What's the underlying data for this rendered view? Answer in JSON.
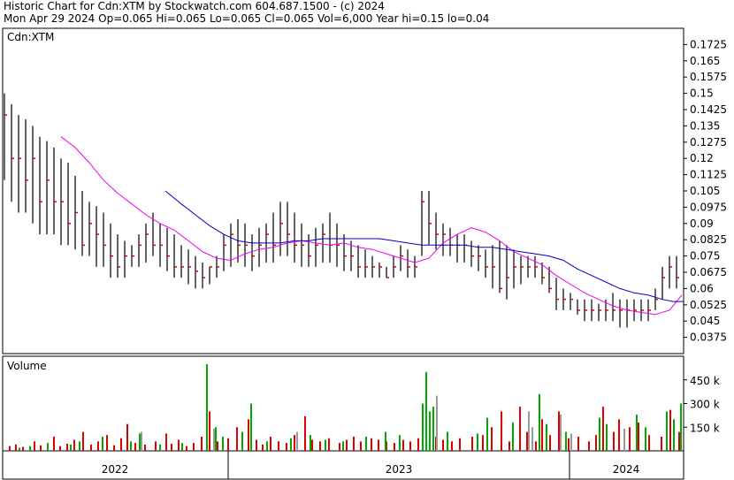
{
  "header": {
    "line1": "Historic Chart for Cdn:XTM by Stockwatch.com 604.687.1500 - (c) 2024",
    "line2": "Mon Apr 29 2024  Op=0.065  Hi=0.065  Lo=0.065  Cl=0.065  Vol=6,000  Year hi=0.15  lo=0.04"
  },
  "chart_data": [
    {
      "type": "line",
      "title": "Cdn:XTM",
      "ylim": [
        0.03,
        0.18
      ],
      "y_ticks": [
        "0.1725",
        "0.165",
        "0.1575",
        "0.15",
        "0.1425",
        "0.135",
        "0.1275",
        "0.12",
        "0.1125",
        "0.105",
        "0.0975",
        "0.09",
        "0.0825",
        "0.075",
        "0.0675",
        "0.06",
        "0.0525",
        "0.045",
        "0.0375"
      ],
      "x_ticks": [
        "2022",
        "2023",
        "2024"
      ],
      "series": [
        {
          "style": "hlc-bars",
          "color": "#000000",
          "tick_color": "#dd0000",
          "x": [
            0,
            8,
            16,
            24,
            32,
            40,
            48,
            56,
            64,
            72,
            80,
            88,
            96,
            104,
            112,
            120,
            128,
            136,
            144,
            152,
            160,
            168,
            176,
            184,
            192,
            200,
            208,
            216,
            224,
            232,
            240,
            248,
            256,
            264,
            272,
            280,
            288,
            296,
            304,
            312,
            320,
            328,
            336,
            344,
            352,
            360,
            368,
            376,
            384,
            392,
            400,
            408,
            416,
            424,
            432,
            440,
            448,
            456,
            464,
            472,
            480,
            488,
            496,
            504,
            512,
            520,
            528,
            536,
            544,
            552,
            560,
            568,
            576,
            584,
            592,
            600,
            608,
            616,
            624,
            632,
            640,
            648,
            656,
            664,
            672,
            680,
            688,
            696,
            704,
            712,
            720,
            728,
            736,
            744,
            752,
            760
          ],
          "hi": [
            0.15,
            0.145,
            0.14,
            0.138,
            0.135,
            0.13,
            0.128,
            0.125,
            0.12,
            0.118,
            0.112,
            0.105,
            0.1,
            0.098,
            0.095,
            0.09,
            0.085,
            0.082,
            0.08,
            0.085,
            0.09,
            0.095,
            0.09,
            0.088,
            0.085,
            0.08,
            0.078,
            0.075,
            0.072,
            0.07,
            0.075,
            0.085,
            0.09,
            0.092,
            0.09,
            0.085,
            0.088,
            0.09,
            0.095,
            0.1,
            0.1,
            0.095,
            0.09,
            0.085,
            0.088,
            0.09,
            0.095,
            0.09,
            0.085,
            0.082,
            0.08,
            0.078,
            0.075,
            0.072,
            0.07,
            0.075,
            0.08,
            0.078,
            0.075,
            0.105,
            0.105,
            0.095,
            0.09,
            0.088,
            0.085,
            0.085,
            0.082,
            0.08,
            0.078,
            0.08,
            0.082,
            0.08,
            0.078,
            0.075,
            0.075,
            0.075,
            0.072,
            0.07,
            0.065,
            0.06,
            0.058,
            0.055,
            0.055,
            0.055,
            0.053,
            0.055,
            0.058,
            0.055,
            0.055,
            0.055,
            0.055,
            0.055,
            0.06,
            0.07,
            0.075,
            0.075
          ],
          "lo": [
            0.11,
            0.1,
            0.095,
            0.095,
            0.09,
            0.085,
            0.085,
            0.085,
            0.08,
            0.08,
            0.078,
            0.075,
            0.075,
            0.07,
            0.07,
            0.065,
            0.065,
            0.065,
            0.07,
            0.07,
            0.072,
            0.075,
            0.07,
            0.068,
            0.065,
            0.065,
            0.062,
            0.06,
            0.06,
            0.062,
            0.065,
            0.068,
            0.07,
            0.072,
            0.07,
            0.068,
            0.07,
            0.072,
            0.072,
            0.075,
            0.075,
            0.072,
            0.07,
            0.07,
            0.07,
            0.072,
            0.072,
            0.07,
            0.068,
            0.068,
            0.065,
            0.065,
            0.065,
            0.065,
            0.065,
            0.065,
            0.068,
            0.065,
            0.065,
            0.075,
            0.08,
            0.078,
            0.075,
            0.075,
            0.072,
            0.072,
            0.07,
            0.068,
            0.065,
            0.06,
            0.058,
            0.055,
            0.06,
            0.062,
            0.065,
            0.065,
            0.062,
            0.058,
            0.05,
            0.05,
            0.05,
            0.048,
            0.045,
            0.045,
            0.045,
            0.045,
            0.045,
            0.042,
            0.042,
            0.045,
            0.045,
            0.045,
            0.05,
            0.055,
            0.06,
            0.06
          ],
          "close": [
            0.14,
            0.12,
            0.12,
            0.11,
            0.12,
            0.1,
            0.11,
            0.1,
            0.1,
            0.09,
            0.095,
            0.08,
            0.09,
            0.085,
            0.08,
            0.075,
            0.07,
            0.075,
            0.075,
            0.08,
            0.085,
            0.08,
            0.08,
            0.075,
            0.07,
            0.07,
            0.07,
            0.068,
            0.065,
            0.07,
            0.07,
            0.08,
            0.085,
            0.08,
            0.08,
            0.075,
            0.08,
            0.085,
            0.08,
            0.09,
            0.085,
            0.08,
            0.08,
            0.075,
            0.08,
            0.085,
            0.08,
            0.08,
            0.075,
            0.075,
            0.07,
            0.07,
            0.07,
            0.07,
            0.065,
            0.07,
            0.075,
            0.07,
            0.07,
            0.1,
            0.09,
            0.085,
            0.085,
            0.08,
            0.08,
            0.08,
            0.075,
            0.075,
            0.07,
            0.07,
            0.06,
            0.065,
            0.07,
            0.07,
            0.07,
            0.07,
            0.065,
            0.06,
            0.055,
            0.055,
            0.055,
            0.05,
            0.05,
            0.05,
            0.05,
            0.05,
            0.05,
            0.05,
            0.05,
            0.05,
            0.05,
            0.05,
            0.055,
            0.065,
            0.07,
            0.065
          ]
        },
        {
          "style": "line",
          "color": "#ee00ee",
          "x": [
            64,
            80,
            96,
            112,
            128,
            144,
            160,
            176,
            192,
            208,
            224,
            240,
            256,
            272,
            288,
            304,
            320,
            336,
            352,
            368,
            384,
            400,
            416,
            432,
            448,
            464,
            480,
            496,
            512,
            528,
            544,
            560,
            576,
            592,
            608,
            624,
            640,
            656,
            672,
            688,
            704,
            720,
            736,
            752,
            766
          ],
          "y": [
            0.13,
            0.125,
            0.118,
            0.11,
            0.104,
            0.099,
            0.094,
            0.09,
            0.087,
            0.082,
            0.077,
            0.074,
            0.073,
            0.076,
            0.078,
            0.079,
            0.081,
            0.082,
            0.081,
            0.08,
            0.081,
            0.079,
            0.078,
            0.076,
            0.074,
            0.072,
            0.074,
            0.081,
            0.085,
            0.088,
            0.086,
            0.082,
            0.077,
            0.074,
            0.071,
            0.066,
            0.062,
            0.058,
            0.055,
            0.052,
            0.05,
            0.049,
            0.048,
            0.05,
            0.057
          ]
        },
        {
          "style": "line",
          "color": "#0000cc",
          "x": [
            182,
            200,
            216,
            232,
            248,
            264,
            280,
            296,
            312,
            328,
            344,
            360,
            376,
            392,
            408,
            424,
            440,
            456,
            472,
            488,
            504,
            520,
            536,
            552,
            568,
            584,
            600,
            616,
            632,
            648,
            664,
            680,
            696,
            712,
            728,
            744,
            756,
            768
          ],
          "y": [
            0.105,
            0.099,
            0.094,
            0.089,
            0.085,
            0.082,
            0.081,
            0.081,
            0.081,
            0.082,
            0.082,
            0.083,
            0.083,
            0.083,
            0.083,
            0.083,
            0.082,
            0.081,
            0.08,
            0.08,
            0.08,
            0.08,
            0.079,
            0.079,
            0.078,
            0.077,
            0.076,
            0.075,
            0.073,
            0.069,
            0.066,
            0.063,
            0.06,
            0.058,
            0.057,
            0.055,
            0.054,
            0.054
          ]
        }
      ]
    },
    {
      "type": "bar",
      "title": "Volume",
      "ylim": [
        0,
        600000
      ],
      "y_ticks": [
        "450 k",
        "300 k",
        "150 k"
      ],
      "series": [
        {
          "name": "down",
          "color": "#dd0000",
          "x": [
            5,
            12,
            20,
            33,
            40,
            55,
            62,
            70,
            78,
            88,
            97,
            105,
            115,
            123,
            131,
            138,
            147,
            158,
            170,
            182,
            188,
            196,
            205,
            213,
            222,
            231,
            240,
            252,
            262,
            275,
            284,
            291,
            300,
            309,
            318,
            327,
            339,
            347,
            356,
            366,
            378,
            386,
            394,
            402,
            414,
            422,
            431,
            440,
            450,
            458,
            467,
            487,
            495,
            505,
            514,
            528,
            540,
            550,
            561,
            570,
            582,
            590,
            600,
            607,
            616,
            626,
            637,
            648,
            660,
            668,
            676,
            688,
            694,
            706,
            716,
            728,
            742,
            752,
            762
          ],
          "v": [
            30000,
            40000,
            25000,
            60000,
            35000,
            90000,
            30000,
            45000,
            70000,
            120000,
            40000,
            60000,
            100000,
            35000,
            80000,
            170000,
            50000,
            40000,
            60000,
            110000,
            45000,
            70000,
            30000,
            50000,
            90000,
            250000,
            60000,
            80000,
            150000,
            200000,
            70000,
            40000,
            90000,
            60000,
            50000,
            100000,
            220000,
            70000,
            60000,
            80000,
            50000,
            70000,
            90000,
            60000,
            80000,
            70000,
            60000,
            50000,
            70000,
            60000,
            80000,
            90000,
            70000,
            60000,
            80000,
            90000,
            100000,
            150000,
            250000,
            60000,
            280000,
            120000,
            60000,
            200000,
            100000,
            250000,
            80000,
            90000,
            60000,
            100000,
            280000,
            120000,
            200000,
            150000,
            180000,
            100000,
            90000,
            260000,
            120000
          ]
        },
        {
          "name": "up",
          "color": "#00aa00",
          "x": [
            16,
            28,
            48,
            74,
            84,
            110,
            142,
            152,
            175,
            200,
            228,
            238,
            246,
            268,
            278,
            296,
            323,
            345,
            362,
            382,
            408,
            430,
            446,
            472,
            476,
            480,
            484,
            500,
            534,
            545,
            574,
            604,
            612,
            634,
            672,
            680,
            714,
            724,
            748,
            756,
            764
          ],
          "v": [
            20000,
            30000,
            50000,
            40000,
            60000,
            90000,
            60000,
            110000,
            40000,
            50000,
            550000,
            150000,
            90000,
            120000,
            300000,
            60000,
            80000,
            100000,
            70000,
            60000,
            90000,
            120000,
            100000,
            300000,
            500000,
            250000,
            280000,
            120000,
            110000,
            210000,
            180000,
            360000,
            170000,
            120000,
            210000,
            170000,
            230000,
            150000,
            250000,
            200000,
            300000
          ]
        },
        {
          "name": "unchanged",
          "color": "#999999",
          "x": [
            154,
            236,
            330,
            488,
            592,
            596,
            628,
            640,
            700
          ],
          "v": [
            120000,
            140000,
            120000,
            350000,
            250000,
            150000,
            230000,
            110000,
            140000
          ]
        }
      ]
    }
  ]
}
